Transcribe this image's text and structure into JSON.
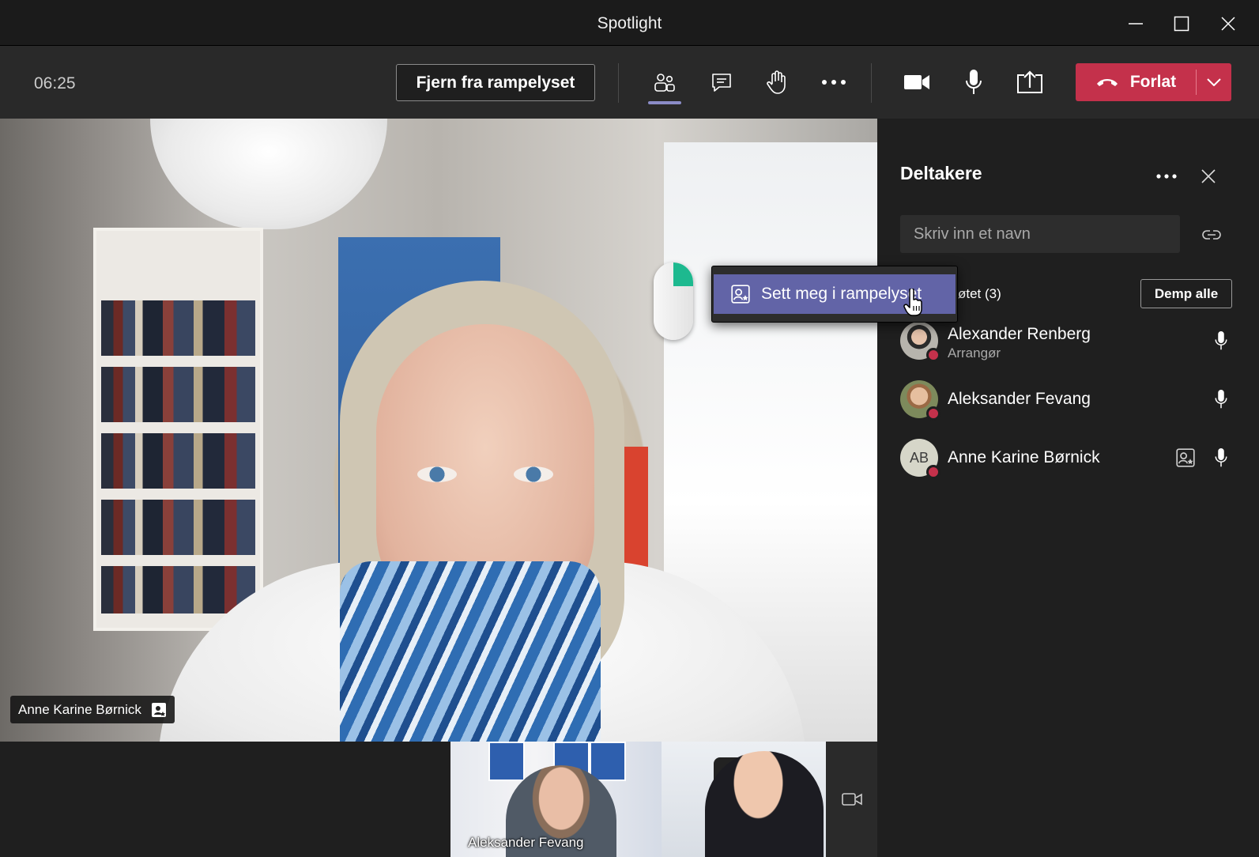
{
  "window": {
    "title": "Spotlight"
  },
  "toolbar": {
    "timer": "06:25",
    "remove_spotlight_label": "Fjern fra rampelyset",
    "leave_label": "Forlat"
  },
  "main_video": {
    "name_tag": "Anne Karine Børnick"
  },
  "thumbnails": [
    {
      "label": "Aleksander Fevang"
    }
  ],
  "context_menu": {
    "item_label": "Sett meg i rampelyset"
  },
  "panel": {
    "title": "Deltakere",
    "search_placeholder": "Skriv inn et navn",
    "section_label": "øtet (3)",
    "mute_all_label": "Demp alle",
    "participants": [
      {
        "name": "Alexander Renberg",
        "role": "Arrangør"
      },
      {
        "name": "Aleksander Fevang",
        "role": ""
      },
      {
        "name": "Anne Karine Børnick",
        "role": "",
        "initials": "AB"
      }
    ]
  },
  "colors": {
    "accent": "#6264a7",
    "leave": "#c4314b",
    "status_busy": "#c4314b"
  }
}
